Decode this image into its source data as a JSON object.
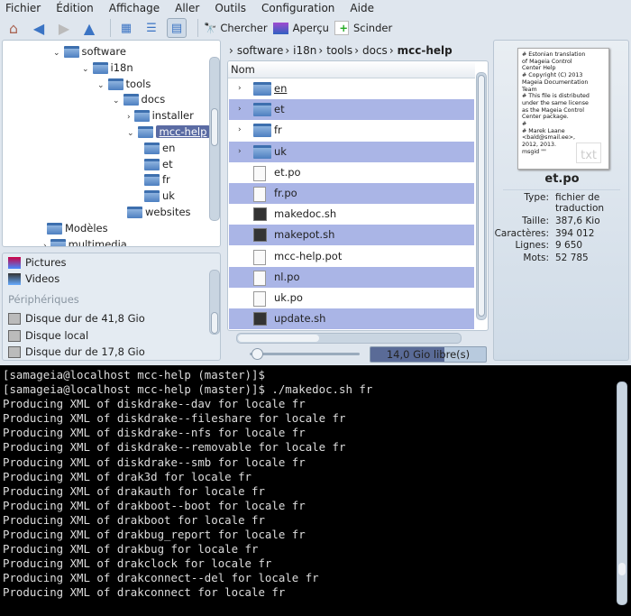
{
  "menu": [
    "Fichier",
    "Édition",
    "Affichage",
    "Aller",
    "Outils",
    "Configuration",
    "Aide"
  ],
  "toolbar": {
    "search": "Chercher",
    "preview": "Aperçu",
    "split": "Scinder"
  },
  "tree": [
    {
      "label": "software",
      "depth": 0
    },
    {
      "label": "i18n",
      "depth": 1
    },
    {
      "label": "tools",
      "depth": 2
    },
    {
      "label": "docs",
      "depth": 3
    },
    {
      "label": "installer",
      "depth": 4
    },
    {
      "label": "mcc-help",
      "depth": 4,
      "selected": true
    },
    {
      "label": "en",
      "depth": 5
    },
    {
      "label": "et",
      "depth": 5
    },
    {
      "label": "fr",
      "depth": 5
    },
    {
      "label": "uk",
      "depth": 5
    },
    {
      "label": "websites",
      "depth": 4
    },
    {
      "label": "Modèles",
      "depth": -1
    },
    {
      "label": "multimedia",
      "depth": -1
    }
  ],
  "places": {
    "items": [
      "Pictures",
      "Videos"
    ],
    "devices_header": "Périphériques",
    "devices": [
      "Disque dur de 41,8 Gio",
      "Disque local",
      "Disque dur de 17,8 Gio"
    ]
  },
  "breadcrumb": [
    "software",
    "i18n",
    "tools",
    "docs",
    "mcc-help"
  ],
  "list": {
    "header": "Nom",
    "rows": [
      {
        "name": "en",
        "type": "folder",
        "selected": false
      },
      {
        "name": "et",
        "type": "folder",
        "selected": true
      },
      {
        "name": "fr",
        "type": "folder",
        "selected": false
      },
      {
        "name": "uk",
        "type": "folder",
        "selected": true
      },
      {
        "name": "et.po",
        "type": "text",
        "selected": false
      },
      {
        "name": "fr.po",
        "type": "text",
        "selected": true
      },
      {
        "name": "makedoc.sh",
        "type": "script",
        "selected": false
      },
      {
        "name": "makepot.sh",
        "type": "script",
        "selected": true
      },
      {
        "name": "mcc-help.pot",
        "type": "text",
        "selected": false
      },
      {
        "name": "nl.po",
        "type": "text",
        "selected": true
      },
      {
        "name": "uk.po",
        "type": "text",
        "selected": false
      },
      {
        "name": "update.sh",
        "type": "script",
        "selected": true
      }
    ]
  },
  "status": {
    "free_space": "14,0 Gio libre(s)",
    "disk_used_fraction": 0.64
  },
  "info": {
    "preview_text": "# Estonian translation\nof Mageia Control\nCenter Help\n# Copyright (C) 2013\nMageia Documentation\nTeam\n# This file is distributed\nunder the same license\nas the Mageia Control\nCenter package.\n#\n# Marek Laane\n<bald@smail.ee>,\n2012, 2013.\nmsgid \"\"",
    "preview_badge": "txt",
    "filename": "et.po",
    "fields": [
      {
        "k": "Type:",
        "v": "fichier de\ntraduction"
      },
      {
        "k": "Taille:",
        "v": "387,6 Kio"
      },
      {
        "k": "Caractères:",
        "v": "394 012"
      },
      {
        "k": "Lignes:",
        "v": "9 650"
      },
      {
        "k": "Mots:",
        "v": "52 785"
      }
    ]
  },
  "terminal": {
    "lines": [
      "[samageia@localhost mcc-help (master)]$",
      "[samageia@localhost mcc-help (master)]$ ./makedoc.sh fr",
      "Producing XML of diskdrake--dav for locale fr",
      "Producing XML of diskdrake--fileshare for locale fr",
      "Producing XML of diskdrake--nfs for locale fr",
      "Producing XML of diskdrake--removable for locale fr",
      "Producing XML of diskdrake--smb for locale fr",
      "Producing XML of drak3d for locale fr",
      "Producing XML of drakauth for locale fr",
      "Producing XML of drakboot--boot for locale fr",
      "Producing XML of drakboot for locale fr",
      "Producing XML of drakbug_report for locale fr",
      "Producing XML of drakbug for locale fr",
      "Producing XML of drakclock for locale fr",
      "Producing XML of drakconnect--del for locale fr",
      "Producing XML of drakconnect for locale fr"
    ]
  }
}
